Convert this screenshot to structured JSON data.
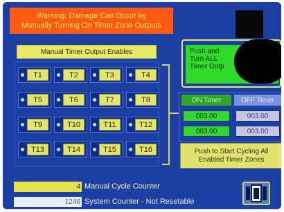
{
  "warning": {
    "line1": "Warning: Damage Can Occur by",
    "line2": "Manually Turning On Timer Zone Outputs"
  },
  "enables": {
    "title": "Manual Timer Output Enables",
    "timers": [
      "T1",
      "T2",
      "T3",
      "T4",
      "T5",
      "T6",
      "T7",
      "T8",
      "T9",
      "T10",
      "T11",
      "T12",
      "T13",
      "T14",
      "T15",
      "T16"
    ]
  },
  "push_all": {
    "line1": "Push and",
    "line2": "Turn ALL",
    "line3": "Timer Outp"
  },
  "timers": {
    "on_label": "ON Timer",
    "off_label": "OFF Timer",
    "on_values": [
      "003.00",
      "003.00"
    ],
    "off_values": [
      "003.00",
      "003.00"
    ]
  },
  "cycle_button": {
    "line1": "Push to Start Cycling All",
    "line2": "Enabled Timer Zones"
  },
  "counters": {
    "manual_value": "4",
    "manual_label": "Manual Cycle Counter",
    "system_value": "1248",
    "system_label": "System Counter - Not Resetable"
  },
  "icons": {
    "menu_button": "panel-switch-icon"
  },
  "colors": {
    "background": "#1c3fa3",
    "warning": "#ff5a14",
    "warning_text": "#ffe95c",
    "enable_yellow": "#e4e470",
    "on_green": "#2eda2a",
    "off_lavender": "#7a93dc"
  }
}
